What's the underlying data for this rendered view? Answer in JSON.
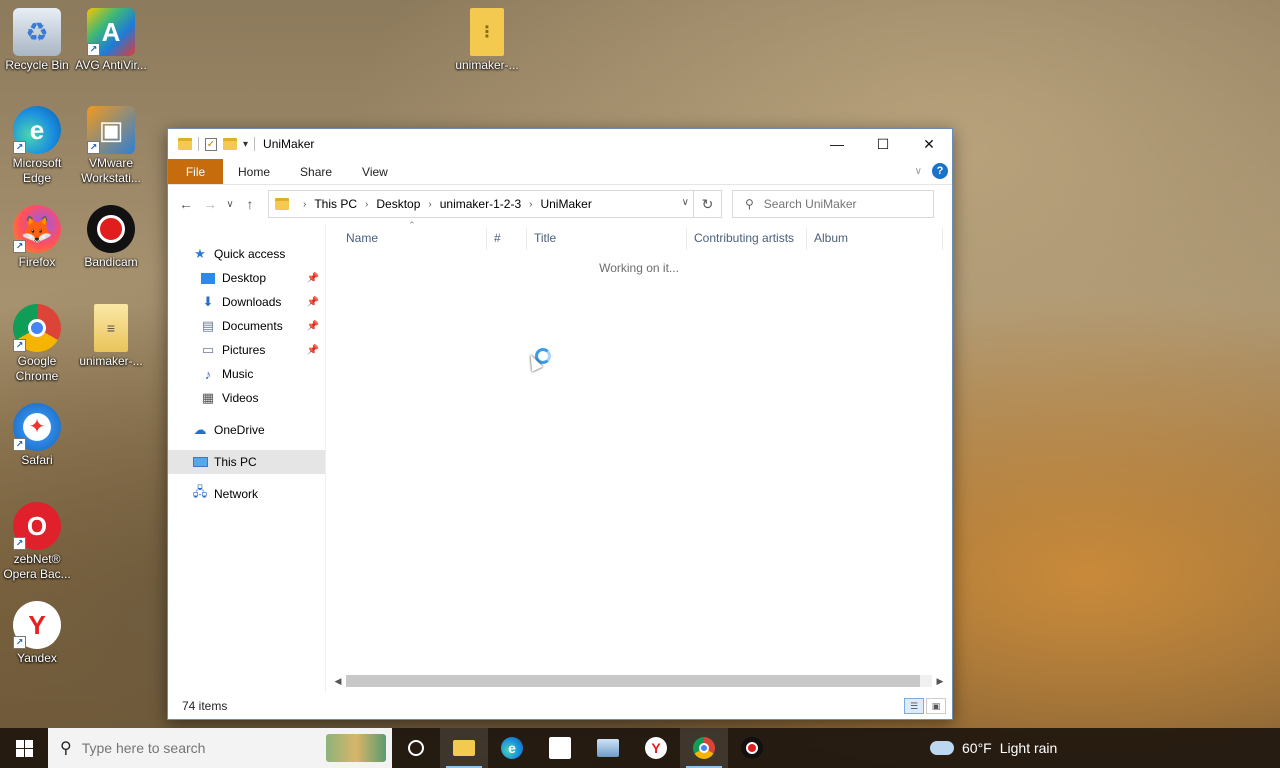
{
  "desktop": {
    "icons": [
      {
        "label": "Recycle Bin",
        "icon": "recycle-bin-icon"
      },
      {
        "label": "AVG AntiVir...",
        "icon": "avg-antivirus-icon"
      },
      {
        "label": "unimaker-...",
        "icon": "zip-folder-icon"
      },
      {
        "label": "Microsoft Edge",
        "icon": "edge-icon"
      },
      {
        "label": "VMware Workstati...",
        "icon": "vmware-icon"
      },
      {
        "label": "Firefox",
        "icon": "firefox-icon"
      },
      {
        "label": "Bandicam",
        "icon": "bandicam-icon"
      },
      {
        "label": "Google Chrome",
        "icon": "chrome-icon"
      },
      {
        "label": "unimaker-...",
        "icon": "document-folder-icon"
      },
      {
        "label": "Safari",
        "icon": "safari-icon"
      },
      {
        "label": "zebNet® Opera Bac...",
        "icon": "opera-backup-icon"
      },
      {
        "label": "Yandex",
        "icon": "yandex-icon"
      }
    ]
  },
  "explorer": {
    "title": "UniMaker",
    "ribbon_tabs": [
      "File",
      "Home",
      "Share",
      "View"
    ],
    "breadcrumbs": [
      "This PC",
      "Desktop",
      "unimaker-1-2-3",
      "UniMaker"
    ],
    "search_placeholder": "Search UniMaker",
    "nav": {
      "quick_access": "Quick access",
      "pinned": [
        {
          "label": "Desktop",
          "icon": "desktop-icon",
          "pinned": true
        },
        {
          "label": "Downloads",
          "icon": "downloads-icon",
          "pinned": true
        },
        {
          "label": "Documents",
          "icon": "documents-icon",
          "pinned": true
        },
        {
          "label": "Pictures",
          "icon": "pictures-icon",
          "pinned": true
        },
        {
          "label": "Music",
          "icon": "music-icon",
          "pinned": false
        },
        {
          "label": "Videos",
          "icon": "videos-icon",
          "pinned": false
        }
      ],
      "onedrive": "OneDrive",
      "this_pc": "This PC",
      "network": "Network"
    },
    "columns": [
      "Name",
      "#",
      "Title",
      "Contributing artists",
      "Album"
    ],
    "status_message": "Working on it...",
    "item_count": "74 items"
  },
  "taskbar": {
    "search_placeholder": "Type here to search",
    "weather": {
      "temp": "60°F",
      "condition": "Light rain"
    }
  },
  "colors": {
    "file_tab": "#c76c0c",
    "accent": "#1a73c8"
  }
}
